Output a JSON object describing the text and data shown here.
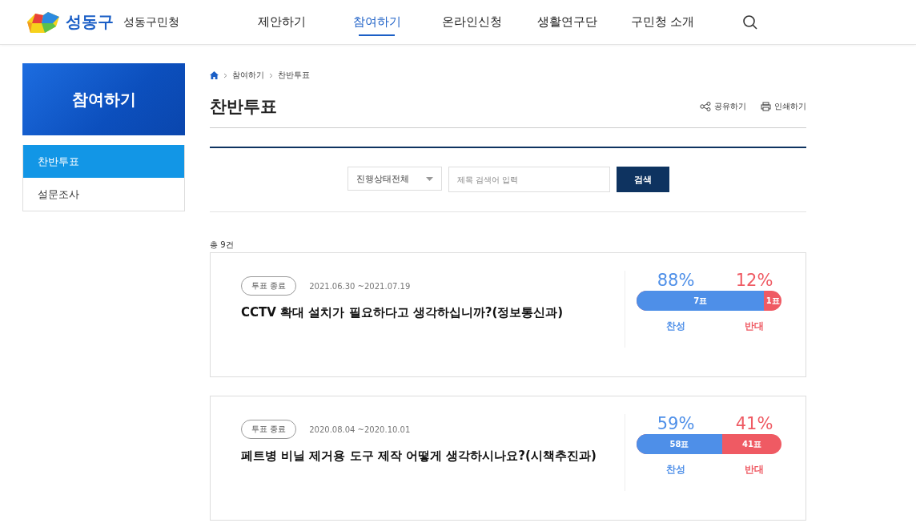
{
  "header": {
    "logo_text": "성동구",
    "site_name": "성동구민청",
    "nav": [
      {
        "label": "제안하기",
        "selected": false
      },
      {
        "label": "참여하기",
        "selected": true
      },
      {
        "label": "온라인신청",
        "selected": false
      },
      {
        "label": "생활연구단",
        "selected": false
      },
      {
        "label": "구민청 소개",
        "selected": false
      }
    ]
  },
  "sidebar": {
    "title": "참여하기",
    "items": [
      {
        "label": "찬반투표",
        "selected": true
      },
      {
        "label": "설문조사",
        "selected": false
      }
    ]
  },
  "breadcrumb": [
    "참여하기",
    "찬반투표"
  ],
  "page_title": "찬반투표",
  "actions": [
    "공유하기",
    "인쇄하기"
  ],
  "search": {
    "status_select": "진행상태전체",
    "placeholder": "제목 검색어 입력",
    "button": "검색"
  },
  "total": "총 9건",
  "polls": [
    {
      "status": "투표 종료",
      "period": "2021.06.30 ~2021.07.19",
      "title": "CCTV 확대 설치가 필요하다고 생각하십니까?(정보통신과)",
      "yes_percent": "88%",
      "no_percent": "12%",
      "level": 0.88,
      "yes_votes": "7표",
      "no_votes": "1표",
      "yes_label": "찬성",
      "no_label": "반대"
    },
    {
      "status": "투표 종료",
      "period": "2020.08.04 ~2020.10.01",
      "title": "페트병 비닐 제거용 도구 제작 어떻게 생각하시나요?(시책추진과)",
      "yes_percent": "59%",
      "no_percent": "41%",
      "level": 0.59,
      "yes_votes": "58표",
      "no_votes": "41표",
      "yes_label": "찬성",
      "no_label": "반대"
    }
  ]
}
